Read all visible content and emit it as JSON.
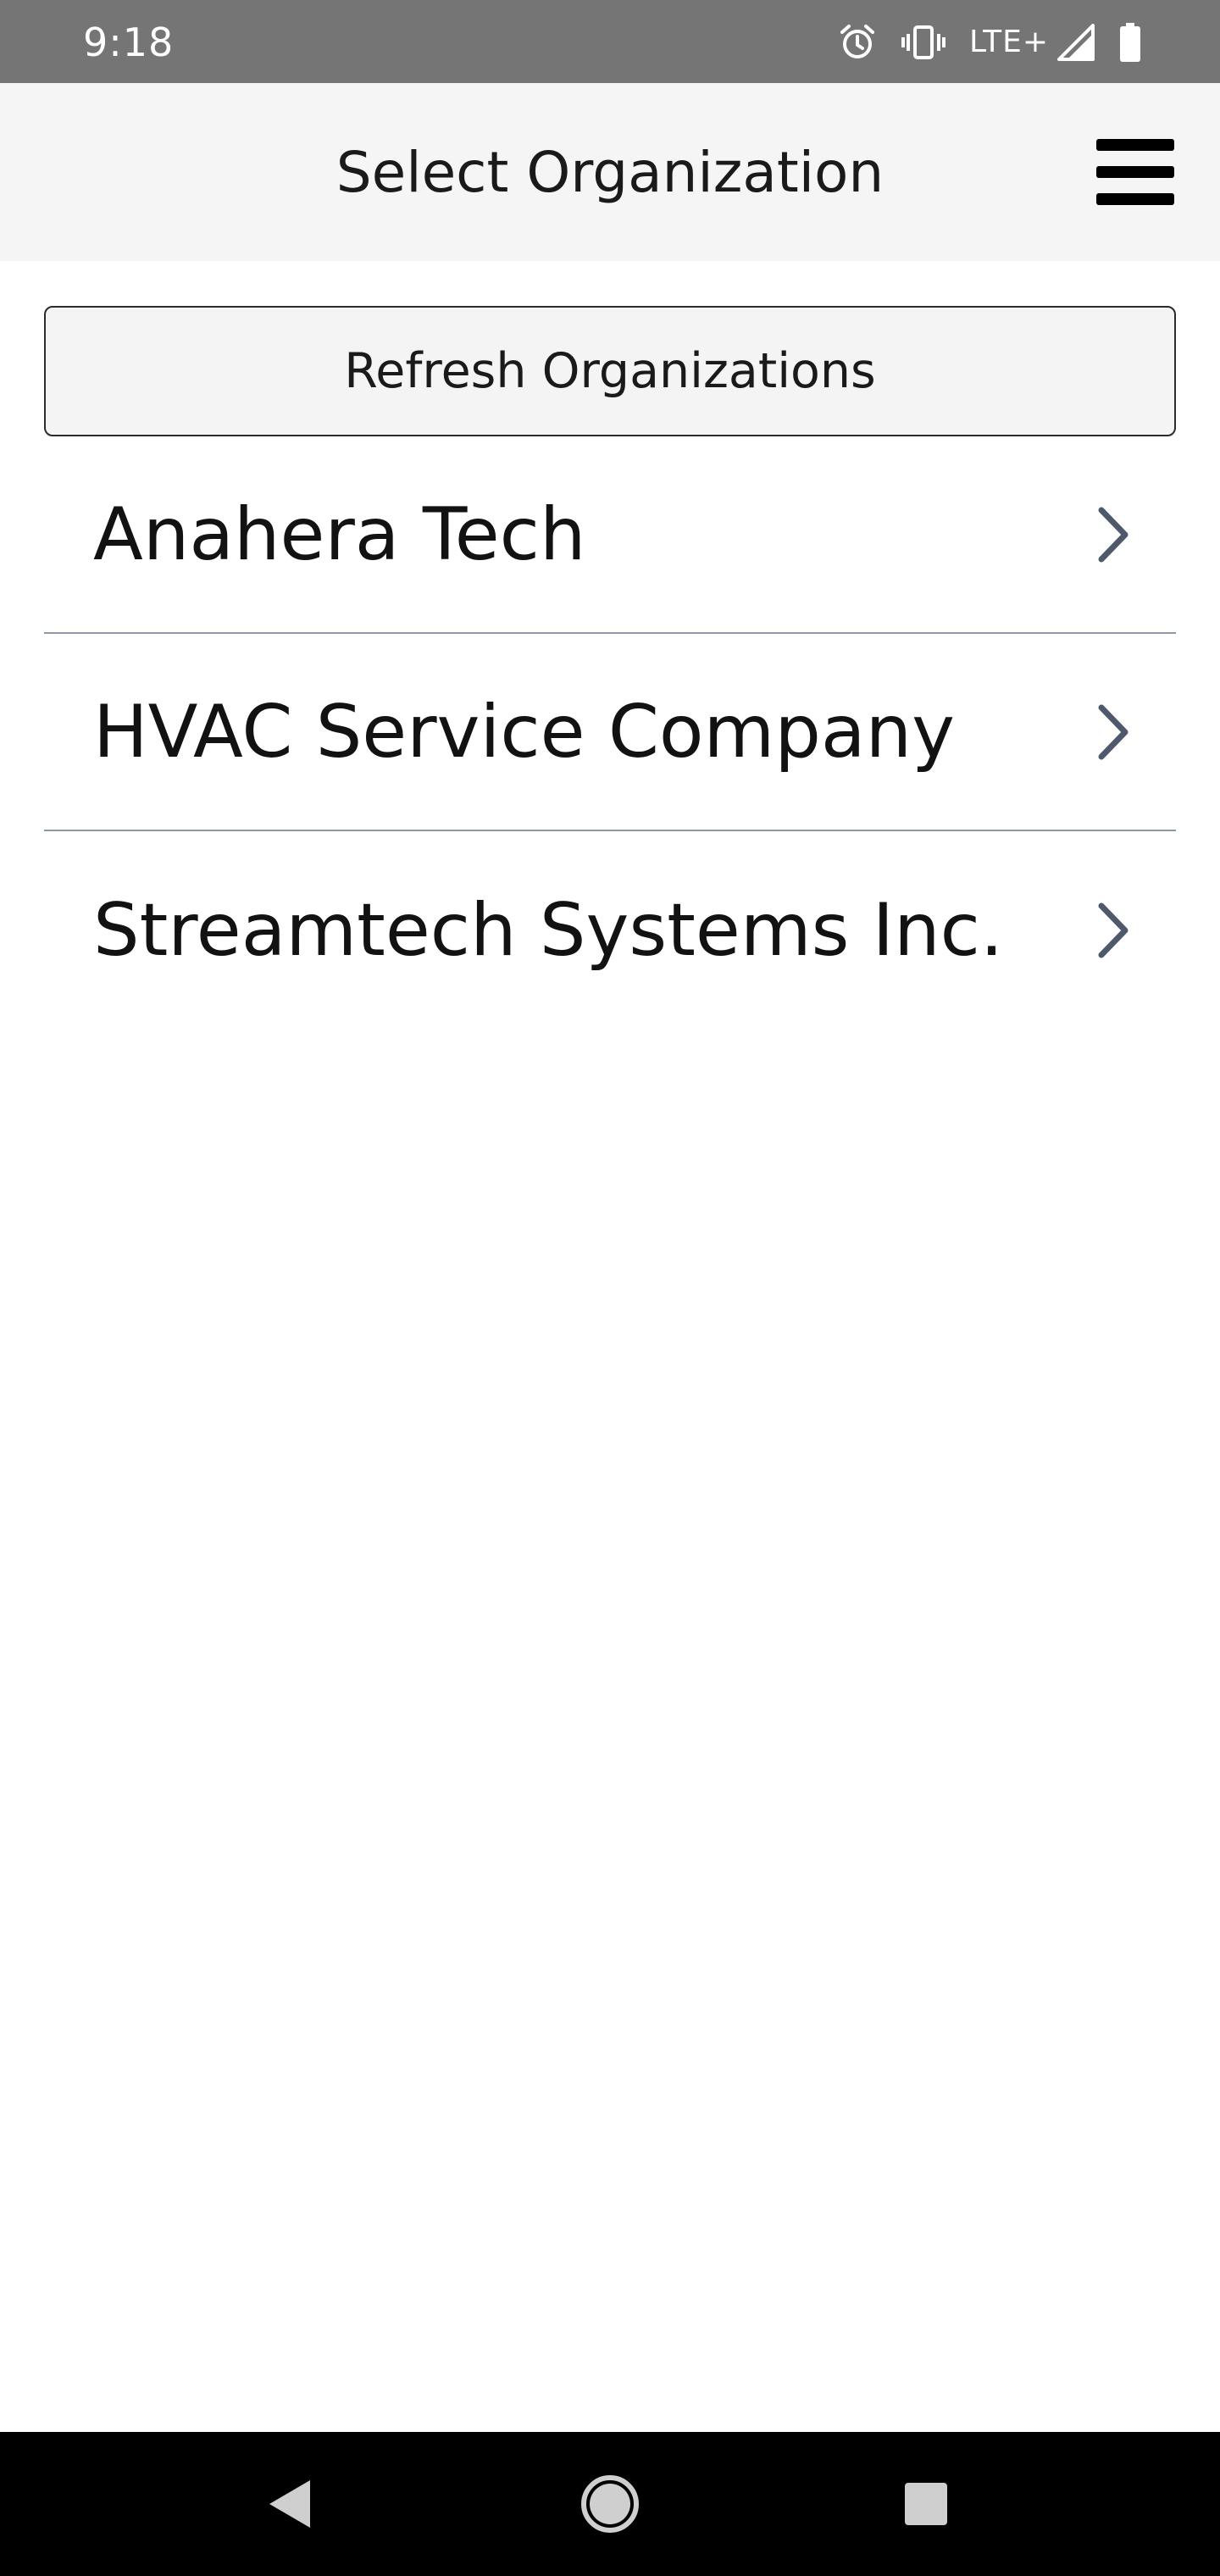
{
  "status_bar": {
    "time": "9:18",
    "network_label": "LTE+",
    "icons": [
      "alarm-icon",
      "vibrate-icon",
      "signal-icon",
      "battery-icon"
    ],
    "color": "#757575"
  },
  "header": {
    "title": "Select Organization",
    "menu_icon": "hamburger-menu-icon",
    "background": "#f5f5f5"
  },
  "refresh": {
    "label": "Refresh Organizations"
  },
  "organizations": [
    {
      "name": "Anahera Tech",
      "icon": "chevron-right-icon"
    },
    {
      "name": "HVAC Service Company",
      "icon": "chevron-right-icon"
    },
    {
      "name": "Streamtech Systems Inc.",
      "icon": "chevron-right-icon"
    }
  ],
  "nav_bar": {
    "buttons": [
      "back-icon",
      "home-icon",
      "recents-icon"
    ]
  },
  "colors": {
    "divider": "#8d98a8",
    "chevron": "#4e5a6b",
    "nav_icons": "#cfcfcf"
  }
}
